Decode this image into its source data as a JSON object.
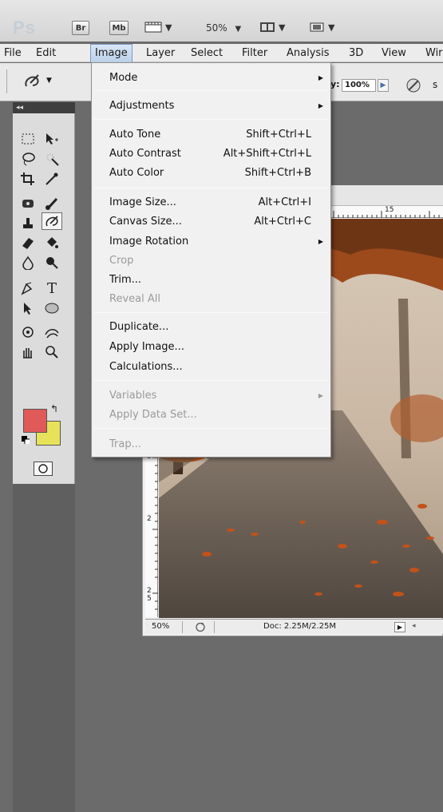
{
  "app_bar": {
    "logo": "Ps",
    "bridge_label": "Br",
    "minibridge_label": "Mb",
    "zoom_level": "50%"
  },
  "menu_bar": {
    "items": [
      "File",
      "Edit",
      "Image",
      "Layer",
      "Select",
      "Filter",
      "Analysis",
      "3D",
      "View",
      "Wir"
    ],
    "active": "Image"
  },
  "options_bar": {
    "opacity_label": "y:",
    "opacity_value": "100%",
    "right_label": "s"
  },
  "image_menu": {
    "mode": "Mode",
    "adjustments": "Adjustments",
    "auto_tone": {
      "label": "Auto Tone",
      "shortcut": "Shift+Ctrl+L"
    },
    "auto_contrast": {
      "label": "Auto Contrast",
      "shortcut": "Alt+Shift+Ctrl+L"
    },
    "auto_color": {
      "label": "Auto Color",
      "shortcut": "Shift+Ctrl+B"
    },
    "image_size": {
      "label": "Image Size...",
      "shortcut": "Alt+Ctrl+I"
    },
    "canvas_size": {
      "label": "Canvas Size...",
      "shortcut": "Alt+Ctrl+C"
    },
    "image_rotation": "Image Rotation",
    "crop": "Crop",
    "trim": "Trim...",
    "reveal_all": "Reveal All",
    "duplicate": "Duplicate...",
    "apply_image": "Apply Image...",
    "calculations": "Calculations...",
    "variables": "Variables",
    "apply_data_set": "Apply Data Set...",
    "trap": "Trap..."
  },
  "document": {
    "ruler_top_marks": [
      "15"
    ],
    "ruler_left_marks": [
      "3",
      "2",
      "2",
      "5"
    ],
    "zoom_status": "50%",
    "doc_size": "Doc: 2.25M/2.25M"
  },
  "colors": {
    "foreground": "#e05a5a",
    "background": "#e8e25a",
    "menu_highlight": "#bcd1ea"
  }
}
